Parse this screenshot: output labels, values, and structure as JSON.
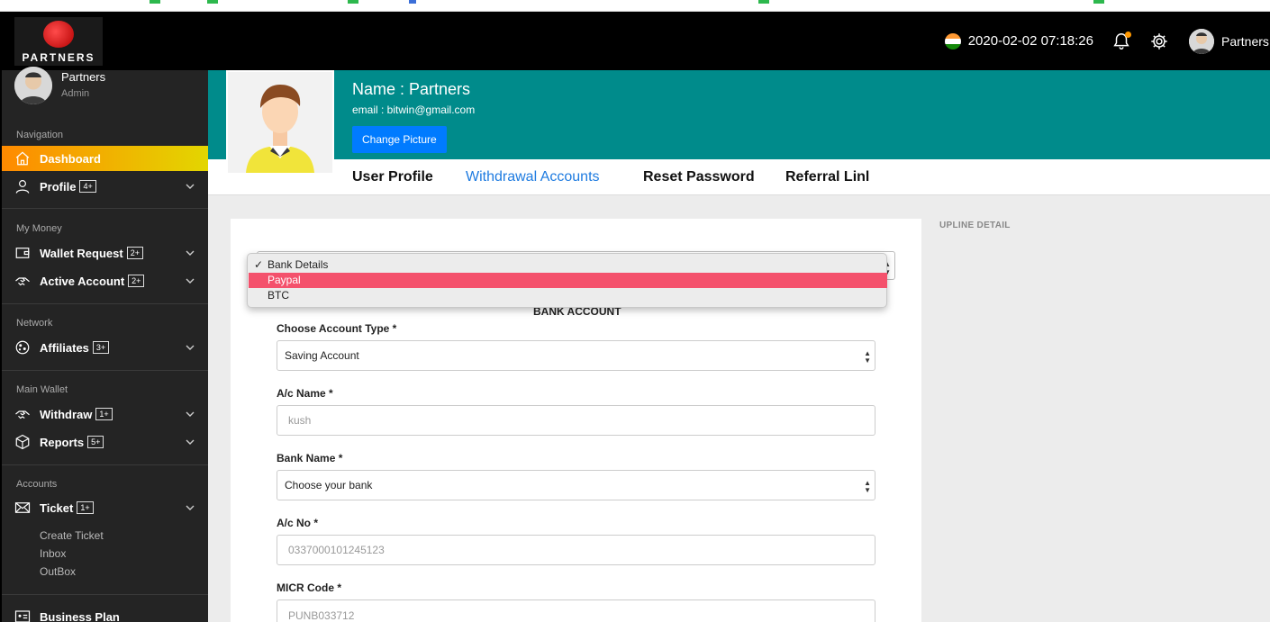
{
  "header": {
    "brand": "PARTNERS",
    "datetime": "2020-02-02 07:18:26",
    "user_name": "Partners"
  },
  "sidebar": {
    "user_name": "Partners",
    "user_role": "Admin",
    "sections": {
      "navigation": "Navigation",
      "my_money": "My Money",
      "network": "Network",
      "main_wallet": "Main Wallet",
      "accounts": "Accounts"
    },
    "items": {
      "dashboard": "Dashboard",
      "profile": "Profile",
      "profile_badge": "4+",
      "wallet_request": "Wallet Request",
      "wallet_request_badge": "2+",
      "active_account": "Active Account",
      "active_account_badge": "2+",
      "affiliates": "Affiliates",
      "affiliates_badge": "3+",
      "withdraw": "Withdraw",
      "withdraw_badge": "1+",
      "reports": "Reports",
      "reports_badge": "5+",
      "ticket": "Ticket",
      "ticket_badge": "1+",
      "create_ticket": "Create Ticket",
      "inbox": "Inbox",
      "outbox": "OutBox",
      "business_plan": "Business Plan"
    }
  },
  "profile": {
    "name": "Name : Partners",
    "email": "email : bitwin@gmail.com",
    "change_picture": "Change Picture",
    "tabs": [
      "User Profile",
      "Withdrawal Accounts",
      "Reset Password",
      "Referral Linl"
    ]
  },
  "upline_title": "UPLINE DETAIL",
  "method_dropdown": {
    "options": [
      "Bank Details",
      "Paypal",
      "BTC"
    ],
    "selected": "Bank Details",
    "highlighted": "Paypal"
  },
  "bank_form": {
    "title": "BANK ACCOUNT",
    "account_type_label": "Choose Account Type *",
    "account_type_value": "Saving Account",
    "ac_name_label": "A/c Name *",
    "ac_name_placeholder": "kush",
    "bank_name_label": "Bank Name *",
    "bank_name_value": "Choose your bank",
    "ac_no_label": "A/c No *",
    "ac_no_placeholder": "0337000101245123",
    "micr_label": "MICR Code *",
    "micr_placeholder": "PUNB033712"
  },
  "colors": {
    "teal_header": "#008b8b",
    "active_tab": "#1e7be0",
    "dropdown_highlight": "#f4516c",
    "dashboard_gradient_start": "#ff8a00",
    "dashboard_gradient_end": "#e3d600",
    "button_blue": "#007bff"
  }
}
